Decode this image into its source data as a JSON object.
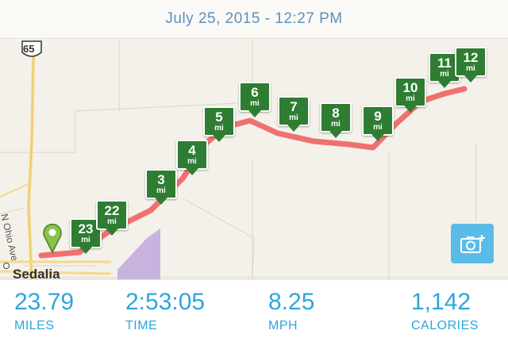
{
  "header": {
    "title": "July 25, 2015 - 12:27 PM"
  },
  "map": {
    "highway_shield": "65",
    "road_label": "N Ohio Ave",
    "city_label": "Sedalia",
    "route_color": "#f07070",
    "marker_color": "#2e7d32",
    "start_pin_color": "#8bc34a",
    "mile_markers": [
      {
        "num": "23",
        "unit": "mi"
      },
      {
        "num": "22",
        "unit": "mi"
      },
      {
        "num": "3",
        "unit": "mi"
      },
      {
        "num": "4",
        "unit": "mi"
      },
      {
        "num": "5",
        "unit": "mi"
      },
      {
        "num": "6",
        "unit": "mi"
      },
      {
        "num": "7",
        "unit": "mi"
      },
      {
        "num": "8",
        "unit": "mi"
      },
      {
        "num": "9",
        "unit": "mi"
      },
      {
        "num": "10",
        "unit": "mi"
      },
      {
        "num": "11",
        "unit": "mi"
      },
      {
        "num": "12",
        "unit": "mi"
      }
    ],
    "camera_icon": "camera-plus-icon"
  },
  "stats": [
    {
      "value": "23.79",
      "label": "MILES"
    },
    {
      "value": "2:53:05",
      "label": "TIME"
    },
    {
      "value": "8.25",
      "label": "MPH"
    },
    {
      "value": "1,142",
      "label": "CALORIES"
    }
  ],
  "colors": {
    "accent": "#2ea5dd",
    "camera_bg": "#5bbbe8",
    "header_text": "#5b8fc0"
  }
}
